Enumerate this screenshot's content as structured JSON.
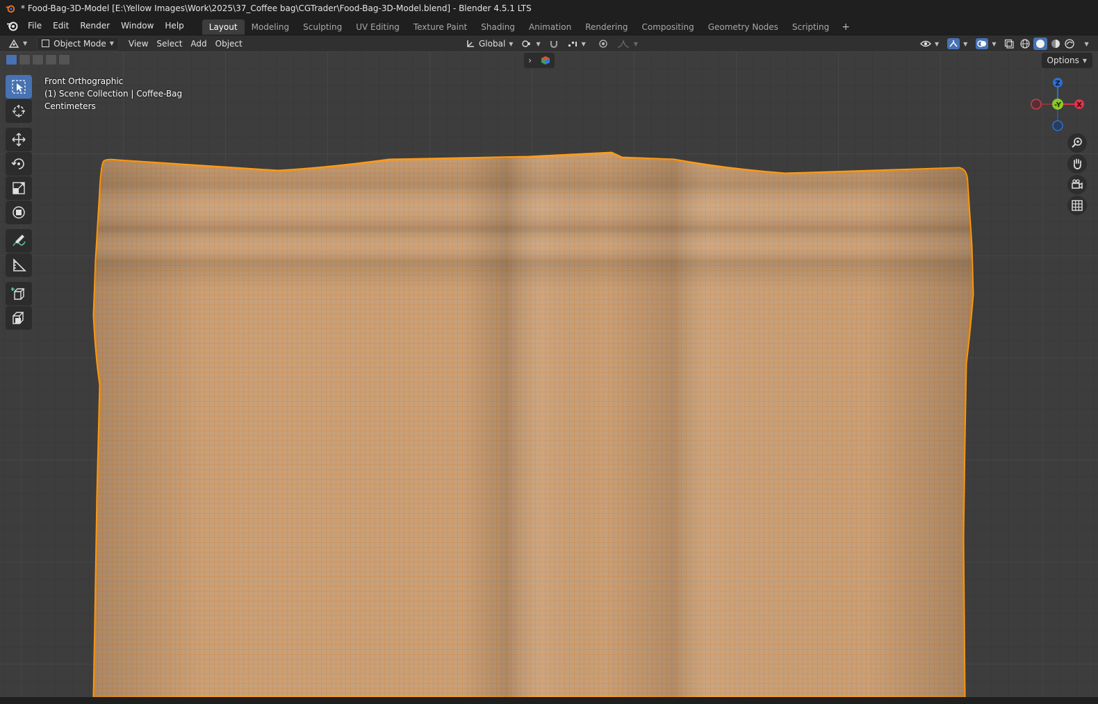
{
  "window": {
    "title": "* Food-Bag-3D-Model [E:\\Yellow Images\\Work\\2025\\37_Coffee bag\\CGTrader\\Food-Bag-3D-Model.blend] - Blender 4.5.1 LTS"
  },
  "menu": {
    "items": [
      "File",
      "Edit",
      "Render",
      "Window",
      "Help"
    ]
  },
  "workspaces": {
    "tabs": [
      "Layout",
      "Modeling",
      "Sculpting",
      "UV Editing",
      "Texture Paint",
      "Shading",
      "Animation",
      "Rendering",
      "Compositing",
      "Geometry Nodes",
      "Scripting"
    ],
    "active": "Layout",
    "add_symbol": "+"
  },
  "header": {
    "mode": "Object Mode",
    "view": "View",
    "select": "Select",
    "add": "Add",
    "object": "Object",
    "orientation": "Global",
    "options": "Options"
  },
  "overlay": {
    "view_name": "Front Orthographic",
    "collection": "(1) Scene Collection | Coffee-Bag",
    "units": "Centimeters"
  },
  "gizmo": {
    "z": "Z",
    "y": "-Y",
    "x": "X",
    "colors": {
      "z": "#2f6fd0",
      "y": "#8ac926",
      "x": "#e0334a",
      "neg_x": "#a8323f",
      "neg_z": "#2b5da8"
    }
  },
  "mesh": {
    "fill_color": "#c8a07a",
    "wire_color": "#e58a2a",
    "outline_color": "#ff9d1c"
  },
  "colors": {
    "accent": "#4772b3"
  }
}
